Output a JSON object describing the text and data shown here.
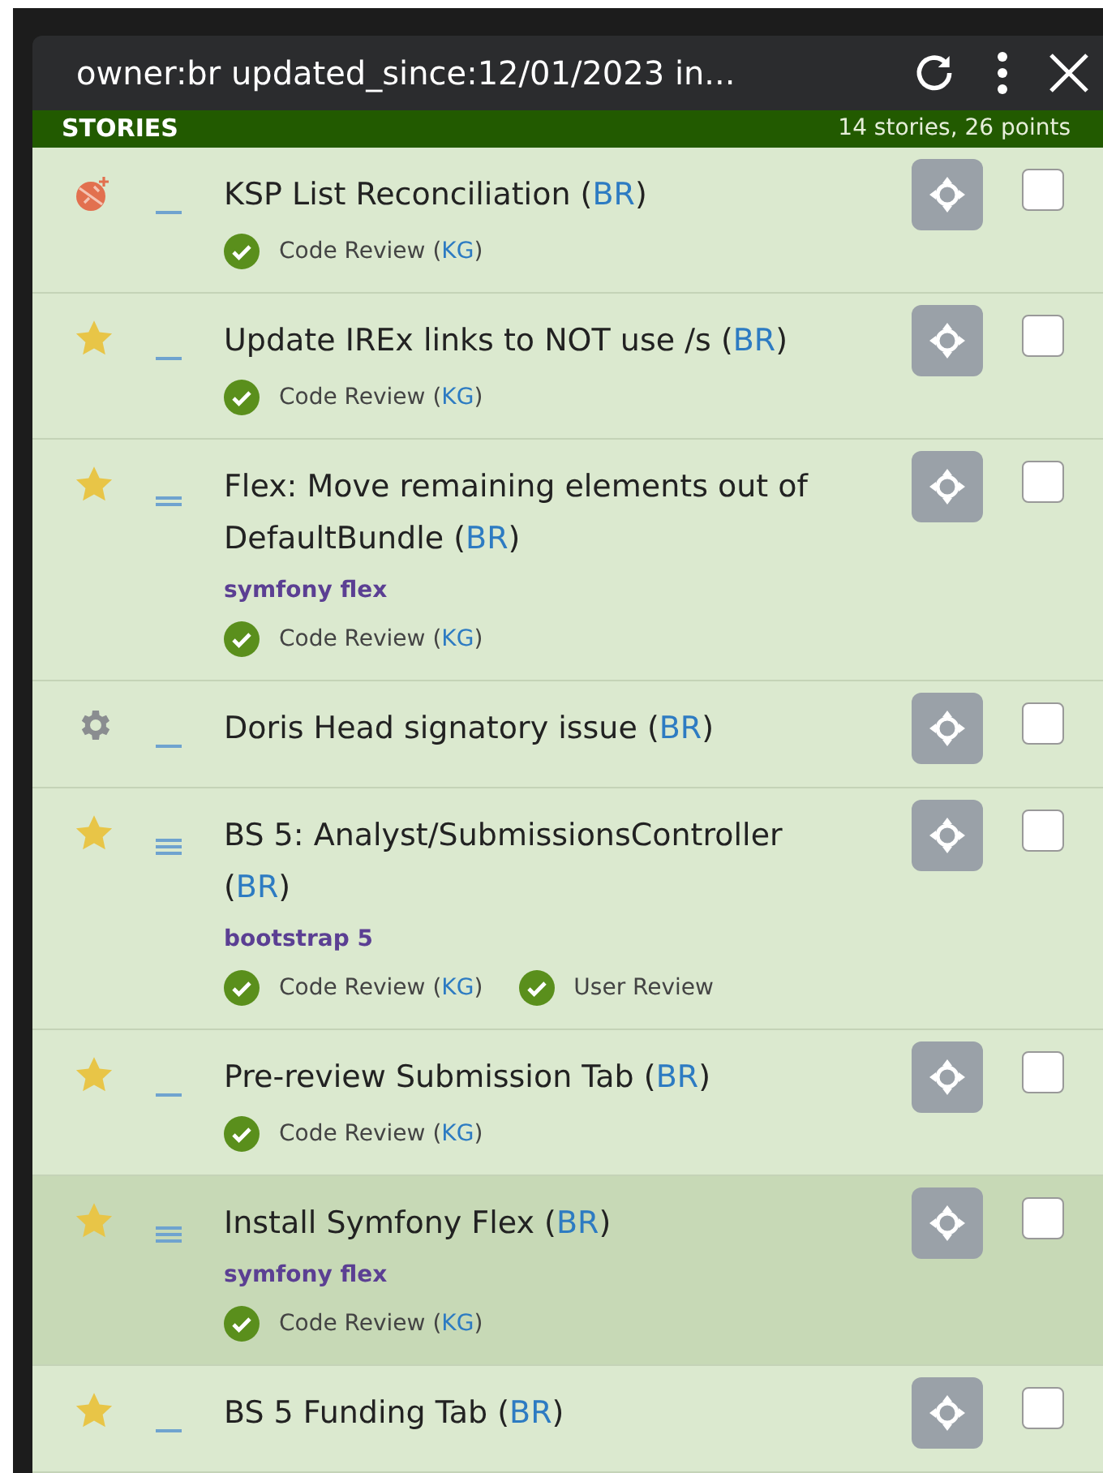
{
  "panel": {
    "title": "owner:br updated_since:12/01/2023 in..."
  },
  "section": {
    "label": "STORIES",
    "summary": "14 stories, 26 points"
  },
  "stories": [
    {
      "kind": "bug",
      "estimate": {
        "kind": "single"
      },
      "title": "KSP List Reconciliation",
      "owner": "(BR)",
      "reviews": [
        {
          "name": "Code Review",
          "reviewer": "(KG)"
        }
      ],
      "highlighted": false,
      "checked": false
    },
    {
      "kind": "feature",
      "estimate": {
        "kind": "single"
      },
      "title": "Update IREx links to NOT use /s",
      "owner": "(BR)",
      "reviews": [
        {
          "name": "Code Review",
          "reviewer": "(KG)"
        }
      ],
      "highlighted": false,
      "checked": false
    },
    {
      "kind": "feature",
      "estimate": {
        "kind": "double"
      },
      "title": "Flex: Move remaining elements out of DefaultBundle",
      "owner": "(BR)",
      "labels": [
        "symfony flex"
      ],
      "reviews": [
        {
          "name": "Code Review",
          "reviewer": "(KG)"
        }
      ],
      "highlighted": false,
      "checked": false
    },
    {
      "kind": "chore",
      "estimate": {
        "kind": "single"
      },
      "title": "Doris Head signatory issue",
      "owner": "(BR)",
      "highlighted": false,
      "checked": false
    },
    {
      "kind": "feature",
      "estimate": {
        "kind": "triple"
      },
      "title": "BS 5: Analyst/SubmissionsController",
      "owner": "(BR)",
      "labels": [
        "bootstrap 5"
      ],
      "reviews": [
        {
          "name": "Code Review",
          "reviewer": "(KG)"
        },
        {
          "name": "User Review"
        }
      ],
      "highlighted": false,
      "checked": false
    },
    {
      "kind": "feature",
      "estimate": {
        "kind": "single"
      },
      "title": "Pre-review Submission Tab",
      "owner": "(BR)",
      "reviews": [
        {
          "name": "Code Review",
          "reviewer": "(KG)"
        }
      ],
      "highlighted": false,
      "checked": false
    },
    {
      "kind": "feature",
      "estimate": {
        "kind": "triple"
      },
      "title": "Install Symfony Flex",
      "owner": "(BR)",
      "labels": [
        "symfony flex"
      ],
      "reviews": [
        {
          "name": "Code Review",
          "reviewer": "(KG)"
        }
      ],
      "highlighted": true,
      "checked": false
    },
    {
      "kind": "feature",
      "estimate": {
        "kind": "single"
      },
      "title": "BS 5 Funding Tab",
      "owner": "(BR)",
      "highlighted": false,
      "checked": false
    }
  ]
}
